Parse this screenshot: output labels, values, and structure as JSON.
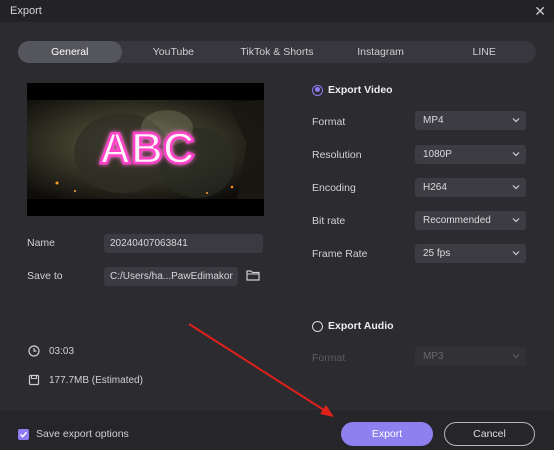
{
  "window": {
    "title": "Export"
  },
  "tabs": [
    {
      "label": "General",
      "active": true
    },
    {
      "label": "YouTube",
      "active": false
    },
    {
      "label": "TikTok & Shorts",
      "active": false
    },
    {
      "label": "Instagram",
      "active": false
    },
    {
      "label": "LINE",
      "active": false
    }
  ],
  "preview": {
    "overlay_text": "ABC"
  },
  "file": {
    "name_label": "Name",
    "name_value": "20240407063841",
    "save_label": "Save to",
    "save_value": "C:/Users/ha...PawEdimakor"
  },
  "info": {
    "duration": "03:03",
    "size": "177.7MB (Estimated)"
  },
  "video": {
    "label": "Export Video",
    "selected": true,
    "options": [
      {
        "label": "Format",
        "value": "MP4"
      },
      {
        "label": "Resolution",
        "value": "1080P"
      },
      {
        "label": "Encoding",
        "value": "H264"
      },
      {
        "label": "Bit rate",
        "value": "Recommended"
      },
      {
        "label": "Frame Rate",
        "value": "25  fps"
      }
    ]
  },
  "audio": {
    "label": "Export Audio",
    "selected": false,
    "options": [
      {
        "label": "Format",
        "value": "MP3"
      }
    ]
  },
  "footer": {
    "save_options_label": "Save export options",
    "save_options_checked": true,
    "export_label": "Export",
    "cancel_label": "Cancel"
  },
  "colors": {
    "accent": "#8e7bf5",
    "background": "#2b2b30",
    "annotation_arrow": "#e0201b"
  }
}
